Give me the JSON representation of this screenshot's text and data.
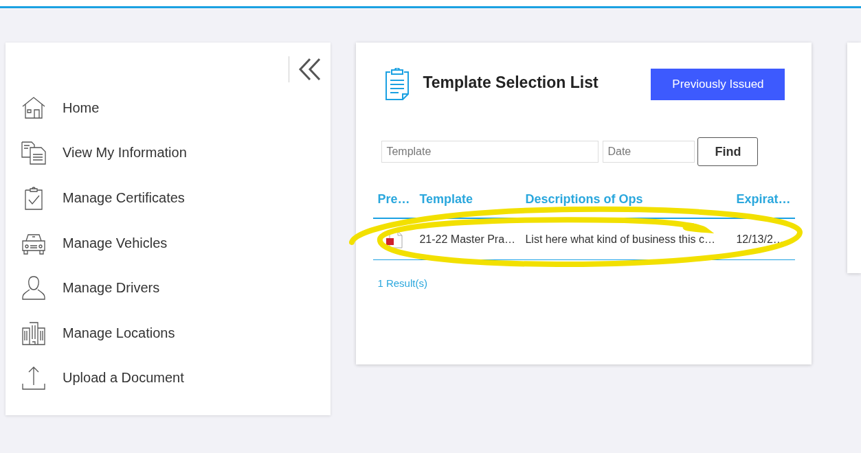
{
  "sidebar": {
    "items": [
      {
        "label": "Home"
      },
      {
        "label": "View My Information"
      },
      {
        "label": "Manage Certificates"
      },
      {
        "label": "Manage Vehicles"
      },
      {
        "label": "Manage Drivers"
      },
      {
        "label": "Manage Locations"
      },
      {
        "label": "Upload a Document"
      }
    ]
  },
  "card": {
    "title": "Template Selection List",
    "action_button": "Previously Issued",
    "search": {
      "template_placeholder": "Template",
      "date_placeholder": "Date",
      "button": "Find"
    },
    "table": {
      "columns": [
        "Pre…",
        "Template",
        "Descriptions of Ops",
        "Expirat…"
      ],
      "rows": [
        {
          "template": "21-22 Master Pra…",
          "description": "List here what kind of business this c…",
          "expiration": "12/13/2…"
        }
      ]
    },
    "result_count": "1 Result(s)"
  }
}
